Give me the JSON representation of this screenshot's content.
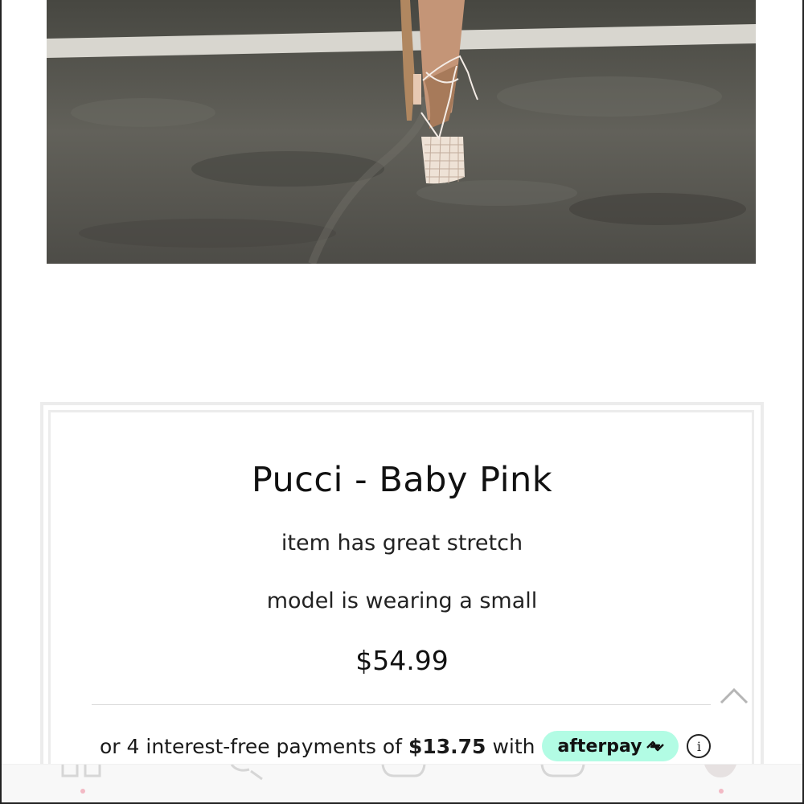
{
  "product": {
    "title": "Pucci - Baby Pink",
    "description_lines": [
      "item has great stretch",
      "model is wearing a small"
    ],
    "price": "$54.99"
  },
  "afterpay": {
    "prefix": "or 4 interest-free payments of",
    "installment": "$13.75",
    "suffix": "with",
    "brand": "afterpay",
    "badge_color": "#b2fce4"
  },
  "photo": {
    "alt": "model wearing lace-up mesh heel on asphalt"
  },
  "bottom_nav": {
    "items": [
      "home-icon",
      "search-icon",
      "chat-icon",
      "bag-icon",
      "profile-icon"
    ],
    "indicator_color": "#f2b9c4"
  }
}
